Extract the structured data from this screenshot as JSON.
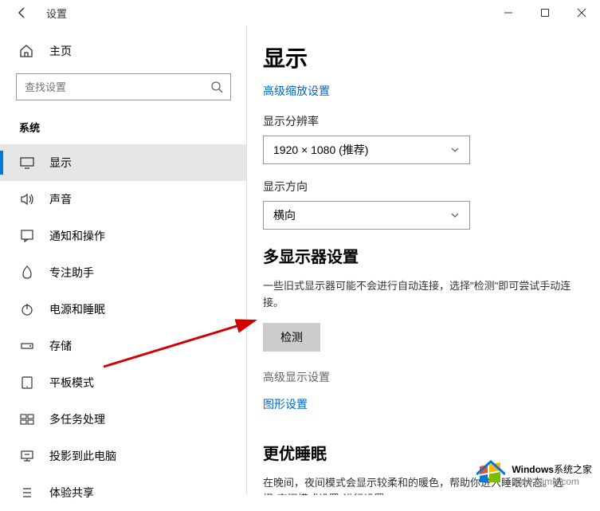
{
  "titlebar": {
    "title": "设置"
  },
  "sidebar": {
    "home": "主页",
    "search_placeholder": "查找设置",
    "category": "系统",
    "items": [
      {
        "label": "显示"
      },
      {
        "label": "声音"
      },
      {
        "label": "通知和操作"
      },
      {
        "label": "专注助手"
      },
      {
        "label": "电源和睡眠"
      },
      {
        "label": "存储"
      },
      {
        "label": "平板模式"
      },
      {
        "label": "多任务处理"
      },
      {
        "label": "投影到此电脑"
      },
      {
        "label": "体验共享"
      }
    ]
  },
  "content": {
    "page_title": "显示",
    "adv_scaling_link": "高级缩放设置",
    "resolution_label": "显示分辨率",
    "resolution_value": "1920 × 1080 (推荐)",
    "orientation_label": "显示方向",
    "orientation_value": "横向",
    "multi_display_title": "多显示器设置",
    "multi_display_desc": "一些旧式显示器可能不会进行自动连接，选择\"检测\"即可尝试手动连接。",
    "detect_btn": "检测",
    "adv_display_link": "高级显示设置",
    "graphics_link": "图形设置",
    "sleep_title": "更优睡眠",
    "sleep_desc": "在晚间，夜间模式会显示较柔和的暖色，帮助你进入睡眠状态。选择\"夜间模式设置\"进行设置。"
  },
  "watermark": {
    "brand": "Windows",
    "brand_suffix": "系统之家",
    "url": "www.bjjmlv.com"
  }
}
